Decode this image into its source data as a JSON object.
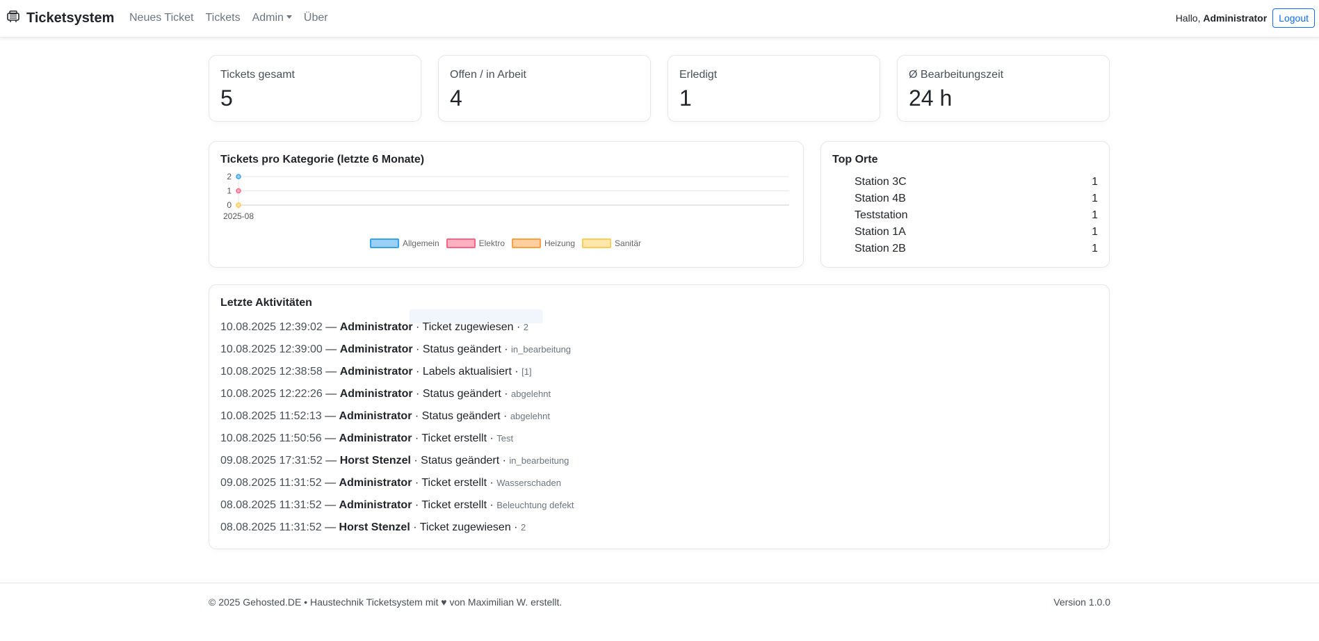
{
  "navbar": {
    "brand": "Ticketsystem",
    "brand_icon": "ticket-machine-icon",
    "links": [
      "Neues Ticket",
      "Tickets",
      "Admin",
      "Über"
    ],
    "greeting_prefix": "Hallo,",
    "user": "Administrator",
    "logout": "Logout"
  },
  "stats": [
    {
      "label": "Tickets gesamt",
      "value": "5"
    },
    {
      "label": "Offen / in Arbeit",
      "value": "4"
    },
    {
      "label": "Erledigt",
      "value": "1"
    },
    {
      "label": "Ø Bearbeitungszeit",
      "value": "24 h"
    }
  ],
  "chart": {
    "title": "Tickets pro Kategorie (letzte 6 Monate)"
  },
  "chart_data": {
    "type": "line",
    "categories": [
      "2025-08"
    ],
    "ylim": [
      0,
      2
    ],
    "yticks": [
      "0",
      "1",
      "2"
    ],
    "grid": true,
    "legend_position": "bottom",
    "series": [
      {
        "name": "Allgemein",
        "values": [
          2
        ],
        "color": "#36a2eb",
        "fill": "#9ad0f5"
      },
      {
        "name": "Elektro",
        "values": [
          1
        ],
        "color": "#ff6384",
        "fill": "#ffb1c1"
      },
      {
        "name": "Heizung",
        "values": [
          0
        ],
        "color": "#ff9f40",
        "fill": "#ffcf9f"
      },
      {
        "name": "Sanitär",
        "values": [
          0
        ],
        "color": "#ffcd56",
        "fill": "#ffe6aa"
      }
    ]
  },
  "top_orte": {
    "title": "Top Orte",
    "items": [
      {
        "name": "Station 3C",
        "count": "1"
      },
      {
        "name": "Station 4B",
        "count": "1"
      },
      {
        "name": "Teststation",
        "count": "1"
      },
      {
        "name": "Station 1A",
        "count": "1"
      },
      {
        "name": "Station 2B",
        "count": "1"
      }
    ]
  },
  "activities": {
    "title": "Letzte Aktivitäten",
    "items": [
      {
        "time": "10.08.2025 12:39:02",
        "user": "Administrator",
        "action": "Ticket zugewiesen",
        "detail": "2"
      },
      {
        "time": "10.08.2025 12:39:00",
        "user": "Administrator",
        "action": "Status geändert",
        "detail": "in_bearbeitung"
      },
      {
        "time": "10.08.2025 12:38:58",
        "user": "Administrator",
        "action": "Labels aktualisiert",
        "detail": "[1]"
      },
      {
        "time": "10.08.2025 12:22:26",
        "user": "Administrator",
        "action": "Status geändert",
        "detail": "abgelehnt"
      },
      {
        "time": "10.08.2025 11:52:13",
        "user": "Administrator",
        "action": "Status geändert",
        "detail": "abgelehnt"
      },
      {
        "time": "10.08.2025 11:50:56",
        "user": "Administrator",
        "action": "Ticket erstellt",
        "detail": "Test"
      },
      {
        "time": "09.08.2025 17:31:52",
        "user": "Horst Stenzel",
        "action": "Status geändert",
        "detail": "in_bearbeitung"
      },
      {
        "time": "09.08.2025 11:31:52",
        "user": "Administrator",
        "action": "Ticket erstellt",
        "detail": "Wasserschaden"
      },
      {
        "time": "08.08.2025 11:31:52",
        "user": "Administrator",
        "action": "Ticket erstellt",
        "detail": "Beleuchtung defekt"
      },
      {
        "time": "08.08.2025 11:31:52",
        "user": "Horst Stenzel",
        "action": "Ticket zugewiesen",
        "detail": "2"
      }
    ]
  },
  "footer": {
    "left": "© 2025 Gehosted.DE • Haustechnik Ticketsystem mit ♥ von Maximilian W. erstellt.",
    "right": "Version 1.0.0"
  }
}
